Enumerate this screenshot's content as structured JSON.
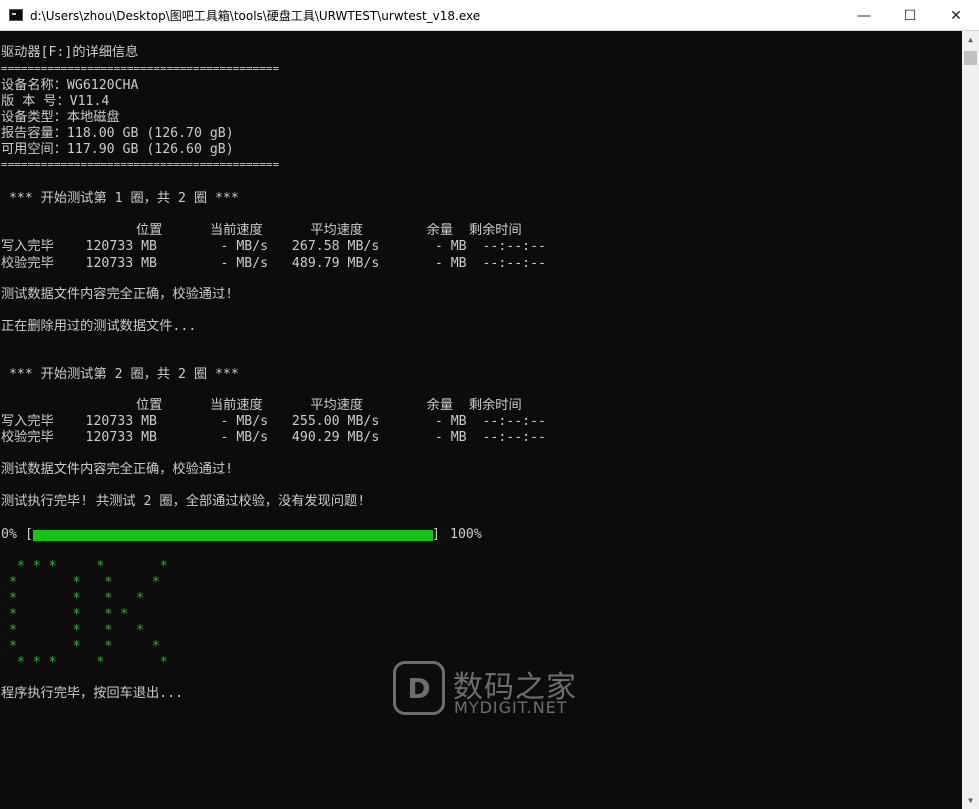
{
  "window": {
    "title": "d:\\Users\\zhou\\Desktop\\图吧工具箱\\tools\\硬盘工具\\URWTEST\\urwtest_v18.exe",
    "app_icon": "console-window-icon",
    "minimize_glyph": "—",
    "maximize_glyph": "☐",
    "close_glyph": "✕"
  },
  "drive_info": {
    "header": "驱动器[F:]的详细信息",
    "separator": "==========================================",
    "device_name": "设备名称：WG6120CHA",
    "version": "版 本 号：V11.4",
    "device_type": "设备类型：本地磁盘",
    "reported_capacity": "报告容量：118.00 GB (126.70 gB)",
    "free_space": "可用空间：117.90 GB (126.60 gB)",
    "separator_end": "=========================================="
  },
  "round1": {
    "heading": " *** 开始测试第 1 圈，共 2 圈 ***",
    "columns": "                 位置      当前速度      平均速度        余量  剩余时间",
    "write_row": "写入完毕    120733 MB        - MB/s   267.58 MB/s       - MB  --:--:--",
    "verify_row": "校验完毕    120733 MB        - MB/s   489.79 MB/s       - MB  --:--:--",
    "result": "测试数据文件内容完全正确，校验通过!",
    "deleting": "正在删除用过的测试数据文件..."
  },
  "round2": {
    "heading": " *** 开始测试第 2 圈，共 2 圈 ***",
    "columns": "                 位置      当前速度      平均速度        余量  剩余时间",
    "write_row": "写入完毕    120733 MB        - MB/s   255.00 MB/s       - MB  --:--:--",
    "verify_row": "校验完毕    120733 MB        - MB/s   490.29 MB/s       - MB  --:--:--",
    "result": "测试数据文件内容完全正确，校验通过!"
  },
  "summary": "测试执行完毕! 共测试 2 圈，全部通过校验，没有发现问题!",
  "progress": {
    "start_label": "0%",
    "open_bracket": "[",
    "close_bracket": "]",
    "end_label": "100%",
    "value": 1.0,
    "fill_color": "#13c413"
  },
  "ok_art": [
    "  * * *     *       *",
    " *       *   *     *",
    " *       *   *   *",
    " *       *   * *",
    " *       *   *   *",
    " *       *   *     *",
    "  * * *     *       *"
  ],
  "exit_prompt": "程序执行完毕，按回车退出...",
  "watermark": {
    "logo_letter": "D",
    "cn": "数码之家",
    "en": "MYDIGIT.NET"
  }
}
